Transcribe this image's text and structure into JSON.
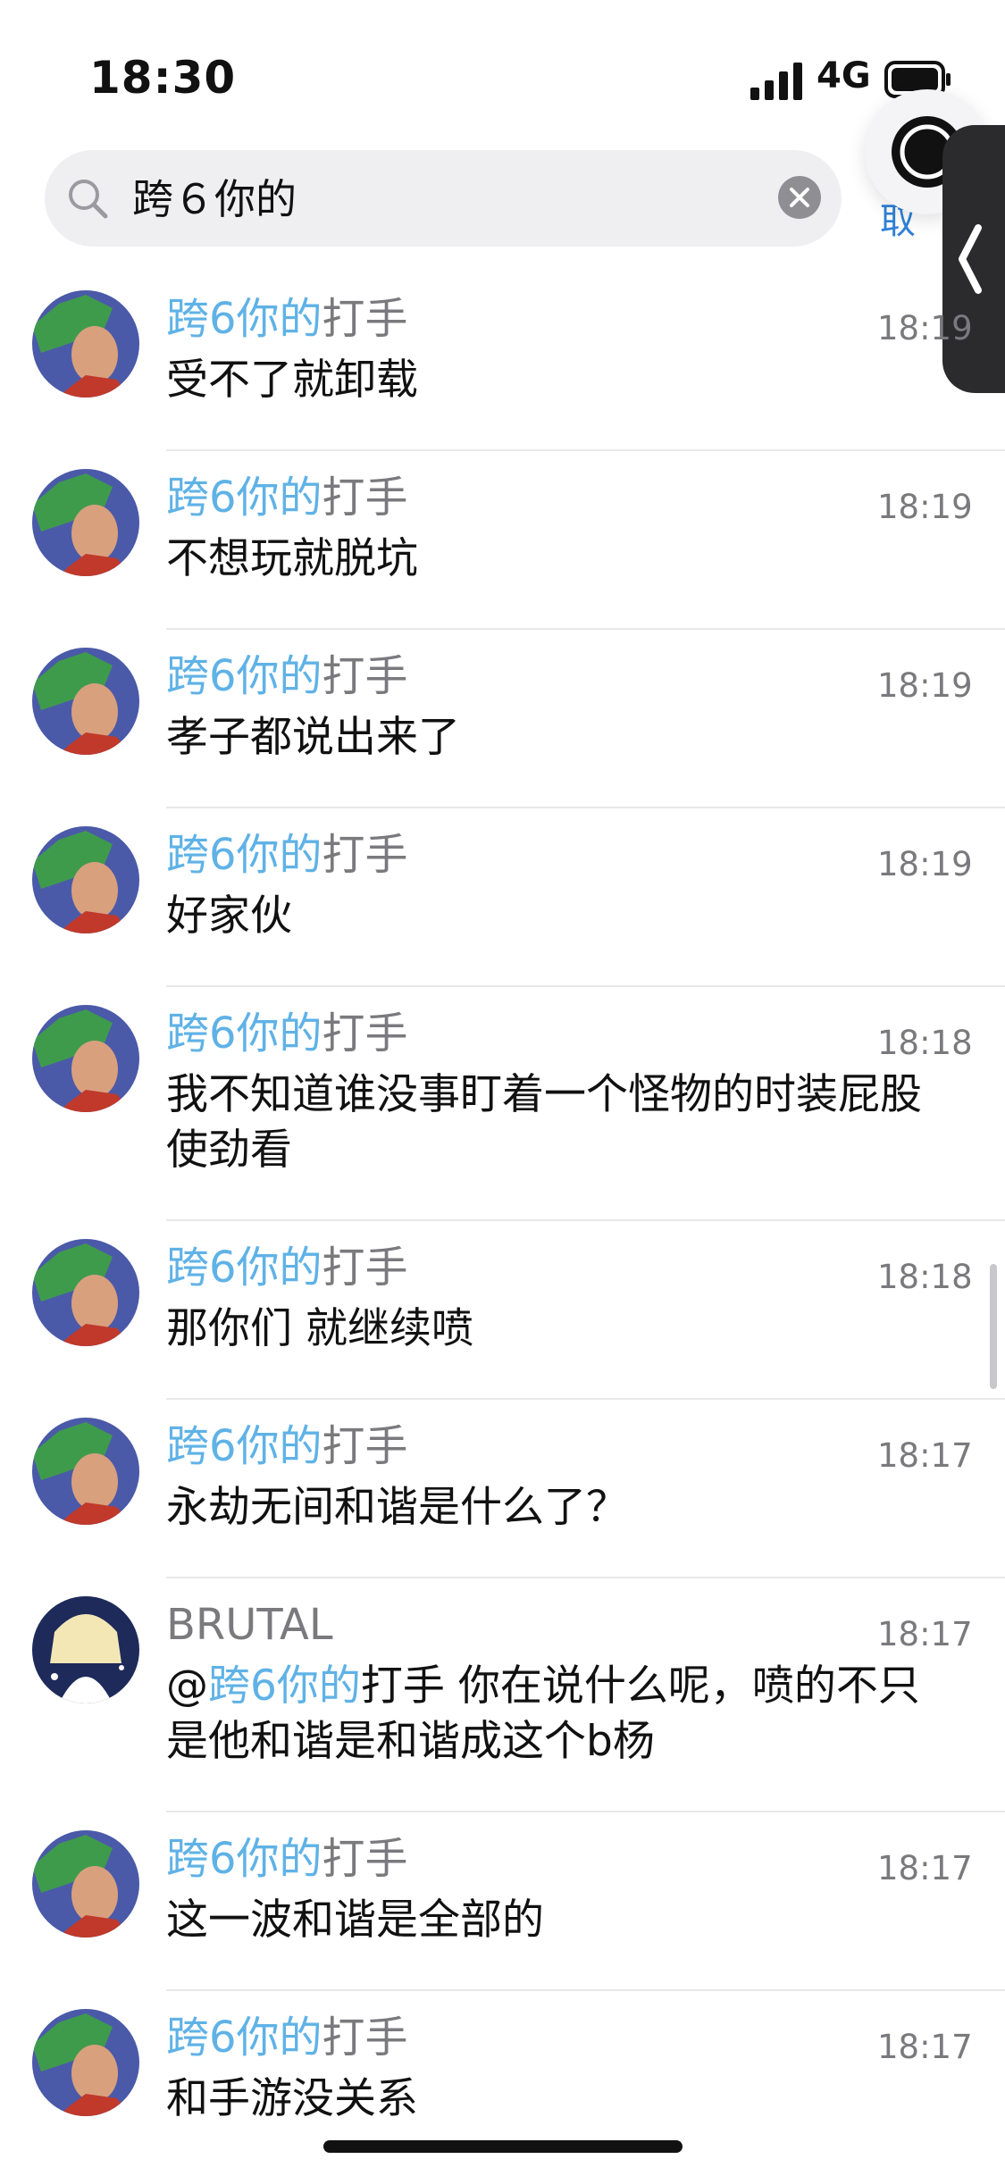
{
  "status_bar": {
    "time": "18:30",
    "network": "4G"
  },
  "search": {
    "query": "跨６你的"
  },
  "search_action_partial": "取",
  "results": [
    {
      "sender_prefix": "跨6你的",
      "sender_suffix": "打手",
      "time": "18:19",
      "message": "受不了就卸载",
      "avatar": "green-hair"
    },
    {
      "sender_prefix": "跨6你的",
      "sender_suffix": "打手",
      "time": "18:19",
      "message": "不想玩就脱坑",
      "avatar": "green-hair"
    },
    {
      "sender_prefix": "跨6你的",
      "sender_suffix": "打手",
      "time": "18:19",
      "message": "孝子都说出来了",
      "avatar": "green-hair"
    },
    {
      "sender_prefix": "跨6你的",
      "sender_suffix": "打手",
      "time": "18:19",
      "message": "好家伙",
      "avatar": "green-hair"
    },
    {
      "sender_prefix": "跨6你的",
      "sender_suffix": "打手",
      "time": "18:18",
      "message": "我不知道谁没事盯着一个怪物的时装屁股 使劲看",
      "avatar": "green-hair"
    },
    {
      "sender_prefix": "跨6你的",
      "sender_suffix": "打手",
      "time": "18:18",
      "message": "那你们 就继续喷",
      "avatar": "green-hair"
    },
    {
      "sender_prefix": "跨6你的",
      "sender_suffix": "打手",
      "time": "18:17",
      "message": "永劫无间和谐是什么了？",
      "avatar": "green-hair"
    },
    {
      "sender_prefix": "",
      "sender_suffix": "BRUTAL",
      "time": "18:17",
      "message_at": "@",
      "message_hl": "跨6你的",
      "message_rest": "打手 你在说什么呢，喷的不只是他和谐是和谐成这个b杨",
      "avatar": "anime-girl"
    },
    {
      "sender_prefix": "跨6你的",
      "sender_suffix": "打手",
      "time": "18:17",
      "message": "这一波和谐是全部的",
      "avatar": "green-hair"
    },
    {
      "sender_prefix": "跨6你的",
      "sender_suffix": "打手",
      "time": "18:17",
      "message": "和手游没关系",
      "avatar": "green-hair"
    }
  ],
  "colors": {
    "highlight": "#5fb2e6",
    "secondary_text": "#7a7a7e",
    "search_bg": "#efeff2"
  }
}
